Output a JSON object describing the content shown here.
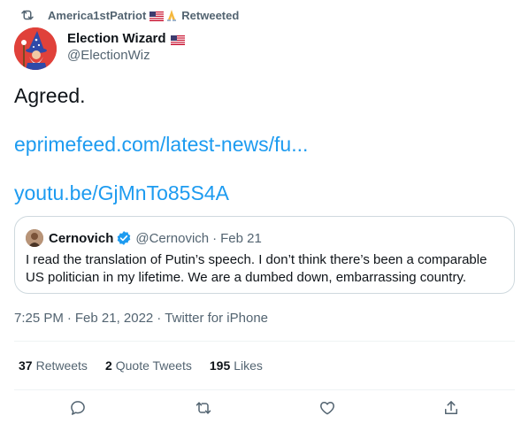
{
  "retweet_bar": {
    "user": "America1stPatriot",
    "label": "Retweeted"
  },
  "author": {
    "name": "Election Wizard",
    "handle": "@ElectionWiz"
  },
  "tweet": {
    "text": "Agreed.",
    "link1": "eprimefeed.com/latest-news/fu...",
    "link2": "youtu.be/GjMnTo85S4A"
  },
  "quoted_tweet": {
    "name": "Cernovich",
    "handle": "@Cernovich",
    "dot": "·",
    "date": "Feb 21",
    "text": "I read the translation of Putin’s speech. I don’t think there’s been a comparable US politician in my lifetime. We are a dumbed down, embarrassing country."
  },
  "meta": {
    "time": "7:25 PM",
    "sep": "·",
    "date": "Feb 21, 2022",
    "source": "Twitter for iPhone"
  },
  "stats": {
    "retweets_count": "37",
    "retweets_label": "Retweets",
    "quotes_count": "2",
    "quotes_label": "Quote Tweets",
    "likes_count": "195",
    "likes_label": "Likes"
  },
  "actions": {
    "reply_icon": "reply-icon",
    "retweet_icon": "retweet-icon",
    "like_icon": "like-icon",
    "share_icon": "share-icon"
  },
  "colors": {
    "link": "#1d9bf0",
    "muted": "#536471",
    "text": "#0f1419",
    "border": "#cfd9de",
    "avatar_bg": "#e0413a"
  }
}
